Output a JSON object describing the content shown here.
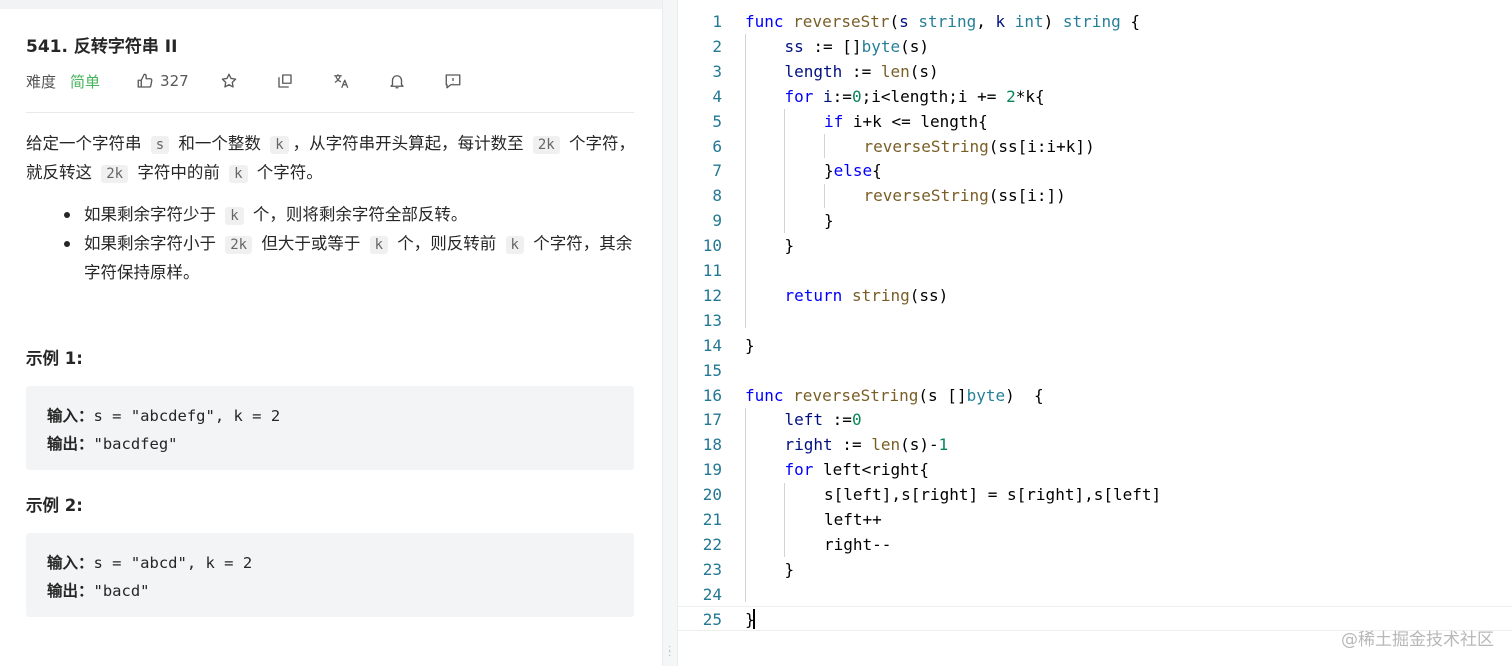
{
  "problem": {
    "title": "541. 反转字符串 II",
    "difficulty_label": "难度",
    "difficulty": "简单",
    "likes": "327",
    "description": [
      {
        "t": "给定一个字符串 "
      },
      {
        "c": "s"
      },
      {
        "t": " 和一个整数 "
      },
      {
        "c": "k"
      },
      {
        "t": "，从字符串开头算起，每计数至 "
      },
      {
        "c": "2k"
      },
      {
        "t": " 个字符，就反转这 "
      },
      {
        "c": "2k"
      },
      {
        "t": " 字符中的前 "
      },
      {
        "c": "k"
      },
      {
        "t": " 个字符。"
      }
    ],
    "bullets": [
      [
        {
          "t": "如果剩余字符少于 "
        },
        {
          "c": "k"
        },
        {
          "t": " 个，则将剩余字符全部反转。"
        }
      ],
      [
        {
          "t": "如果剩余字符小于 "
        },
        {
          "c": "2k"
        },
        {
          "t": " 但大于或等于 "
        },
        {
          "c": "k"
        },
        {
          "t": " 个，则反转前 "
        },
        {
          "c": "k"
        },
        {
          "t": " 个字符，其余字符保持原样。"
        }
      ]
    ],
    "examples": [
      {
        "title": "示例 1:",
        "input_label": "输入：",
        "input": "s = \"abcdefg\", k = 2",
        "output_label": "输出：",
        "output": "\"bacdfeg\""
      },
      {
        "title": "示例 2:",
        "input_label": "输入：",
        "input": "s = \"abcd\", k = 2",
        "output_label": "输出：",
        "output": "\"bacd\""
      }
    ]
  },
  "editor": {
    "lines": [
      [
        [
          "kw",
          "func "
        ],
        [
          "fn",
          "reverseStr"
        ],
        [
          "p",
          "("
        ],
        [
          "vr",
          "s "
        ],
        [
          "ty",
          "string"
        ],
        [
          "p",
          ", "
        ],
        [
          "vr",
          "k "
        ],
        [
          "ty",
          "int"
        ],
        [
          "p",
          ") "
        ],
        [
          "ty",
          "string"
        ],
        [
          "p",
          " {"
        ]
      ],
      [
        [
          "vr",
          "ss"
        ],
        [
          "p",
          " := []"
        ],
        [
          "ty",
          "byte"
        ],
        [
          "p",
          "(s)"
        ]
      ],
      [
        [
          "vr",
          "length"
        ],
        [
          "p",
          " := "
        ],
        [
          "fn",
          "len"
        ],
        [
          "p",
          "(s)"
        ]
      ],
      [
        [
          "kw",
          "for "
        ],
        [
          "vr",
          "i"
        ],
        [
          "p",
          ":="
        ],
        [
          "num",
          "0"
        ],
        [
          "p",
          ";i<length;i += "
        ],
        [
          "num",
          "2"
        ],
        [
          "p",
          "*k{"
        ]
      ],
      [
        [
          "kw",
          "if "
        ],
        [
          "p",
          "i+k <= length{"
        ]
      ],
      [
        [
          "fn",
          "reverseString"
        ],
        [
          "p",
          "(ss[i:i+k])"
        ]
      ],
      [
        [
          "p",
          "}"
        ],
        [
          "kw",
          "else"
        ],
        [
          "p",
          "{"
        ]
      ],
      [
        [
          "fn",
          "reverseString"
        ],
        [
          "p",
          "(ss[i:])"
        ]
      ],
      [
        [
          "p",
          "}"
        ]
      ],
      [
        [
          "p",
          "}"
        ]
      ],
      [],
      [
        [
          "kw",
          "return "
        ],
        [
          "fn",
          "string"
        ],
        [
          "p",
          "(ss)"
        ]
      ],
      [],
      [
        [
          "p",
          "}"
        ]
      ],
      [],
      [
        [
          "kw",
          "func "
        ],
        [
          "fn",
          "reverseString"
        ],
        [
          "p",
          "(s []"
        ],
        [
          "ty",
          "byte"
        ],
        [
          "p",
          ")  {"
        ]
      ],
      [
        [
          "vr",
          "left"
        ],
        [
          "p",
          " :="
        ],
        [
          "num",
          "0"
        ]
      ],
      [
        [
          "vr",
          "right"
        ],
        [
          "p",
          " := "
        ],
        [
          "fn",
          "len"
        ],
        [
          "p",
          "(s)-"
        ],
        [
          "num",
          "1"
        ]
      ],
      [
        [
          "kw",
          "for "
        ],
        [
          "p",
          "left<right{"
        ]
      ],
      [
        [
          "p",
          "s[left],s[right] = s[right],s[left]"
        ]
      ],
      [
        [
          "p",
          "left++"
        ]
      ],
      [
        [
          "p",
          "right--"
        ]
      ],
      [
        [
          "p",
          "}"
        ]
      ],
      [],
      [
        [
          "p",
          "}"
        ]
      ]
    ]
  },
  "watermark": "@稀土掘金技术社区"
}
